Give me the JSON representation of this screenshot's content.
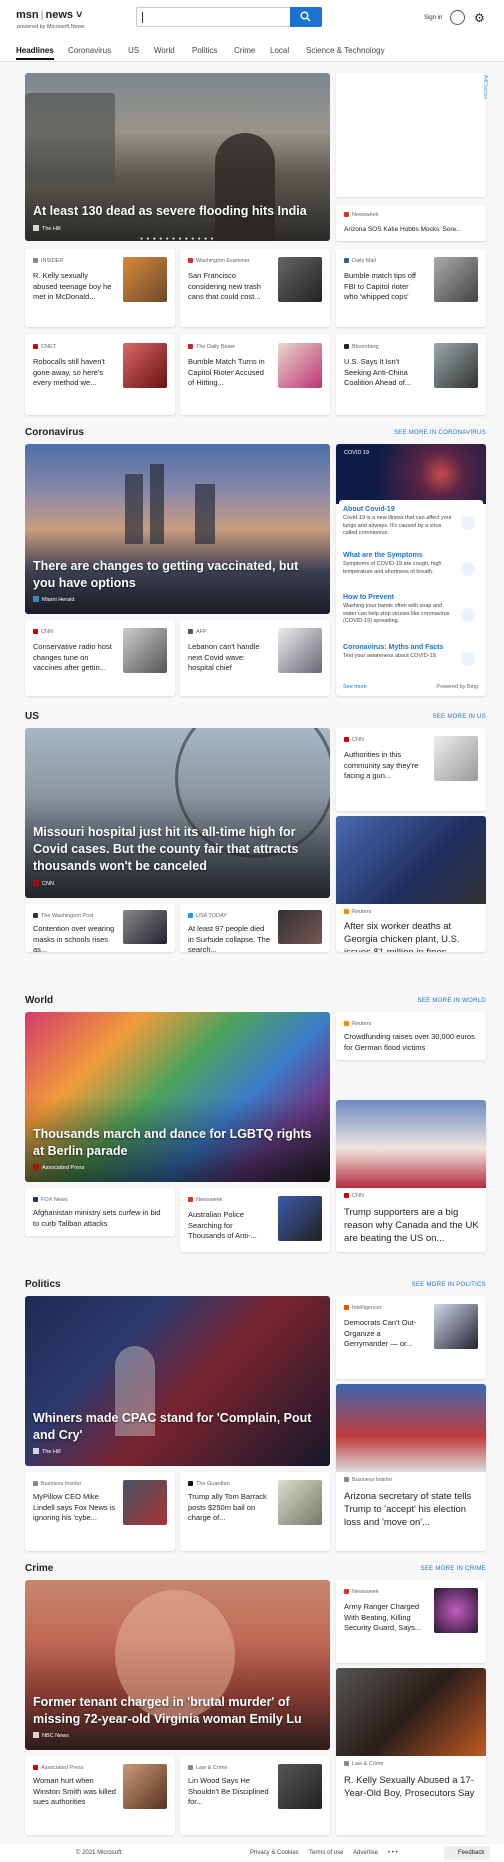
{
  "header": {
    "brand": "msn",
    "section": "news",
    "powered_by": "powered by Microsoft News",
    "search_value": "",
    "signin": "Sign in"
  },
  "nav": [
    "Headlines",
    "Coronavirus",
    "US",
    "World",
    "Politics",
    "Crime",
    "Local",
    "Science & Technology"
  ],
  "top": {
    "hero": {
      "title": "At least 130 dead as severe flooding hits India",
      "source": "The Hill"
    },
    "ad_label": "AdChoices",
    "side": {
      "source": "Newsweek",
      "title": "Arizona SOS Katie Hobbs Mocks 'Sore..."
    },
    "cards": [
      {
        "source": "INSIDER",
        "title": "R. Kelly sexually abused teenage boy he met in McDonald..."
      },
      {
        "source": "Washington Examiner",
        "title": "San Francisco considering new trash cans that could cost..."
      },
      {
        "source": "Daily Mail",
        "title": "Bumble match tips off FBI to Capitol rioter who 'whipped cops'"
      },
      {
        "source": "CNET",
        "title": "Robocalls still haven't gone away, so here's every method we..."
      },
      {
        "source": "The Daily Beast",
        "title": "Bumble Match Turns in Capitol Rioter Accused of Hitting..."
      },
      {
        "source": "Bloomberg",
        "title": "U.S. Says It Isn't Seeking Anti-China Coalition Ahead of..."
      }
    ]
  },
  "coronavirus": {
    "title": "Coronavirus",
    "see_more": "SEE MORE IN CORONAVIRUS",
    "hero": {
      "title": "There are changes to getting vaccinated, but you have options",
      "source": "Miami Herald"
    },
    "panel": {
      "tag": "COVID 19",
      "items": [
        {
          "title": "About Covid-19",
          "text": "Covid-19 is a new illness that can affect your lungs and airways. It's caused by a virus called coronavirus."
        },
        {
          "title": "What are the Symptoms",
          "text": "Symptoms of COVID-19 are cough, high temperature and shortness of breath."
        },
        {
          "title": "How to Prevent",
          "text": "Washing your hands often with soap and water can help stop viruses like coronavirus (COVID-19) spreading."
        },
        {
          "title": "Coronavirus: Myths and Facts",
          "text": "Test your awareness about COVID-19."
        }
      ],
      "see_more": "See more",
      "powered": "Powered by Bing"
    },
    "cards": [
      {
        "source": "CNN",
        "title": "Conservative radio host changes tune on vaccines after gettin..."
      },
      {
        "source": "AFP",
        "title": "Lebanon can't handle next Covid wave: hospital chief"
      }
    ]
  },
  "us": {
    "title": "US",
    "see_more": "SEE MORE IN US",
    "hero": {
      "title": "Missouri hospital just hit its all-time high for Covid cases. But the county fair that attracts thousands won't be canceled",
      "source": "CNN"
    },
    "side": {
      "source": "CNN",
      "title": "Authorities in this community say they're facing a gun..."
    },
    "side2": {
      "source": "Reuters",
      "title": "After six worker deaths at Georgia chicken plant, U.S. issues $1 million in fines"
    },
    "cards": [
      {
        "source": "The Washington Post",
        "title": "Contention over wearing masks in schools rises as..."
      },
      {
        "source": "USA TODAY",
        "title": "At least 97 people died in Surfside collapse. The search..."
      }
    ]
  },
  "world": {
    "title": "World",
    "see_more": "SEE MORE IN WORLD",
    "hero": {
      "title": "Thousands march and dance for LGBTQ rights at Berlin parade",
      "source": "Associated Press"
    },
    "side": {
      "source": "Reuters",
      "title": "Crowdfunding raises over 30,000 euros for German flood victims"
    },
    "side2": {
      "source": "CNN",
      "title": "Trump supporters are a big reason why Canada and the UK are beating the US on..."
    },
    "cards": [
      {
        "source": "FOX News",
        "title": "Afghanistan ministry sets curfew in bid to curb Taliban attacks"
      },
      {
        "source": "Newsweek",
        "title": "Australian Police Searching for Thousands of Anti-..."
      }
    ]
  },
  "politics": {
    "title": "Politics",
    "see_more": "SEE MORE IN POLITICS",
    "hero": {
      "title": "Whiners made CPAC stand for 'Complain, Pout and Cry'",
      "source": "The Hill"
    },
    "side": {
      "source": "Intelligencer",
      "title": "Democrats Can't Out-Organize a Gerrymander — or..."
    },
    "side2": {
      "source": "Business Insider",
      "title": "Arizona secretary of state tells Trump to 'accept' his election loss and 'move on'..."
    },
    "cards": [
      {
        "source": "Business Insider",
        "title": "MyPillow CEO Mike Lindell says Fox News is ignoring his 'cybe..."
      },
      {
        "source": "The Guardian",
        "title": "Trump ally Tom Barrack posts $250m bail on charge of..."
      }
    ]
  },
  "crime": {
    "title": "Crime",
    "see_more": "SEE MORE IN CRIME",
    "hero": {
      "title": "Former tenant charged in 'brutal murder' of missing 72-year-old Virginia woman Emily Lu",
      "source": "NBC News"
    },
    "side": {
      "source": "Newsweek",
      "title": "Army Ranger Charged With Beating, Killing Security Guard, Says..."
    },
    "side2": {
      "source": "Law & Crime",
      "title": "R. Kelly Sexually Abused a 17-Year-Old Boy, Prosecutors Say"
    },
    "cards": [
      {
        "source": "Associated Press",
        "title": "Woman hurt when Winston Smith was killed sues authorities"
      },
      {
        "source": "Law & Crime",
        "title": "Lin Wood Says He Shouldn't Be Disciplined for..."
      }
    ]
  },
  "footer": {
    "copyright": "© 2021 Microsoft",
    "privacy": "Privacy & Cookies",
    "terms": "Terms of use",
    "advertise": "Advertise",
    "more": "• • •",
    "feedback": "Feedback"
  }
}
